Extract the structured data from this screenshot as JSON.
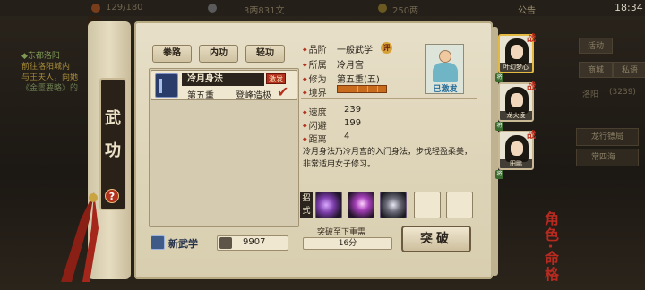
{
  "hud": {
    "energy": "129/180",
    "silver": "3两831文",
    "gold": "250两",
    "notice": "公告",
    "time": "18:34"
  },
  "quest": {
    "title": "◆东都洛阳",
    "line1": "前往洛阳城内",
    "line2": "与王夫人，向她",
    "line3": "《金匮要略》的"
  },
  "right_menu": {
    "items": [
      "活动",
      "商城",
      "私语"
    ],
    "location": "洛阳",
    "coords": "(3239)",
    "btn1": "龙行镖局",
    "btn2": "常四海",
    "fate": "角色·命格"
  },
  "left_panel": {
    "title_chars": [
      "武",
      "功"
    ],
    "help": "?"
  },
  "tabs": [
    "拳路",
    "内功",
    "轻功"
  ],
  "skill": {
    "name": "冷月身法",
    "badge": "激发",
    "level": "第五重",
    "stat": "登峰造极"
  },
  "new_skill_label": "新武学",
  "coins": "9907",
  "info": {
    "grade_label": "品阶",
    "grade_value": "一般武学",
    "grade_badge": "评",
    "school_label": "所属",
    "school_value": "冷月宫",
    "cult_label": "修为",
    "cult_value": "第五重(五)",
    "realm_label": "境界",
    "mastered": "已激发",
    "speed_label": "速度",
    "speed_value": "239",
    "dodge_label": "闪避",
    "dodge_value": "199",
    "range_label": "距离",
    "range_value": "4",
    "description": "冷月身法乃冷月宫的入门身法，步伐轻盈柔美，非常适用女子修习。",
    "moves_tag": "招式",
    "bt_label": "突破至下重需",
    "bt_value": "16分",
    "break_btn": "突破"
  },
  "characters": [
    {
      "name": "叶幻梦心",
      "tag": "战",
      "qi": "将"
    },
    {
      "name": "龙火凌",
      "tag": "战",
      "qi": "将"
    },
    {
      "name": "田鹏",
      "tag": "战",
      "qi": "将"
    }
  ],
  "colors": {
    "accent_red": "#b3321e",
    "paper": "#e7dfc8",
    "dark": "#2b241c",
    "realm_orange": "#c86b1d"
  }
}
